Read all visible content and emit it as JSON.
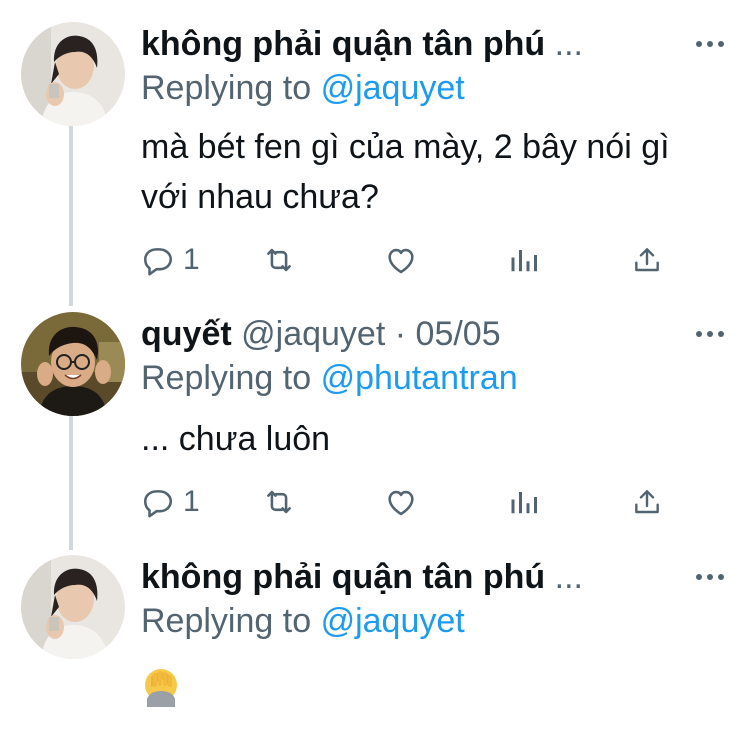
{
  "tweets": [
    {
      "display_name": "không phải quận tân phú",
      "ellipsis": "...",
      "reply_prefix": "Replying to",
      "reply_handle": "@jaquyet",
      "body": "mà bét fen gì của mày, 2 bây nói gì với nhau chưa?",
      "reply_count": "1",
      "avatar": "avatar-photo-1"
    },
    {
      "display_name": "quyết",
      "handle": "@jaquyet",
      "dot": "·",
      "date": "05/05",
      "reply_prefix": "Replying to",
      "reply_handle": "@phutantran",
      "body": "... chưa luôn",
      "reply_count": "1",
      "avatar": "avatar-photo-2"
    },
    {
      "display_name": "không phải quận tân phú",
      "ellipsis": "...",
      "reply_prefix": "Replying to",
      "reply_handle": "@jaquyet",
      "body_emoji": "facepalm-emoji",
      "avatar": "avatar-photo-1"
    }
  ],
  "icons": {
    "reply": "reply-icon",
    "retweet": "retweet-icon",
    "like": "heart-icon",
    "analytics": "analytics-icon",
    "share": "share-icon",
    "more": "more-icon"
  },
  "colors": {
    "muted": "#536471",
    "link": "#1d9bf0",
    "thread_line": "#cfd9de",
    "text": "#0f1419"
  }
}
